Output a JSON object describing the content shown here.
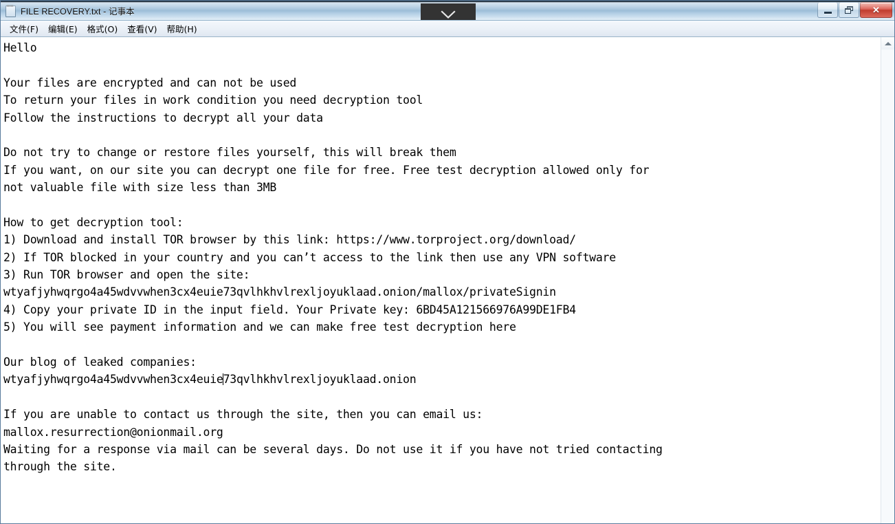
{
  "window": {
    "title": "FILE RECOVERY.txt - 记事本",
    "icon": "notepad-icon",
    "controls": {
      "minimize_label": "—",
      "restore_label": "❐",
      "close_label": "✕"
    }
  },
  "overlay": {
    "chevron_icon": "chevron-down-icon",
    "background_color": "#333333"
  },
  "menubar": {
    "items": [
      {
        "label": "文件(F)",
        "name": "menu-file"
      },
      {
        "label": "编辑(E)",
        "name": "menu-edit"
      },
      {
        "label": "格式(O)",
        "name": "menu-format"
      },
      {
        "label": "查看(V)",
        "name": "menu-view"
      },
      {
        "label": "帮助(H)",
        "name": "menu-help"
      }
    ]
  },
  "document": {
    "filename": "FILE RECOVERY.txt",
    "private_key": "6BD45A121566976A99DE1FB4",
    "tor_download_url": "https://www.torproject.org/download/",
    "onion_signin_url": "wtyafjyhwqrgo4a45wdvvwhen3cx4euie73qvlhkhvlrexljoyuklaad.onion/mallox/privateSignin",
    "onion_blog_url": "wtyafjyhwqrgo4a45wdvvwhen3cx4euie73qvlhkhvlrexljoyuklaad.onion",
    "email": "mallox.resurrection@onionmail.org",
    "max_free_file_size": "3MB",
    "lines": [
      "Hello",
      "",
      "Your files are encrypted and can not be used",
      "To return your files in work condition you need decryption tool",
      "Follow the instructions to decrypt all your data",
      "",
      "Do not try to change or restore files yourself, this will break them",
      "If you want, on our site you can decrypt one file for free. Free test decryption allowed only for",
      "not valuable file with size less than 3MB",
      "",
      "How to get decryption tool:",
      "1) Download and install TOR browser by this link: https://www.torproject.org/download/",
      "2) If TOR blocked in your country and you can’t access to the link then use any VPN software",
      "3) Run TOR browser and open the site:",
      "wtyafjyhwqrgo4a45wdvvwhen3cx4euie73qvlhkhvlrexljoyuklaad.onion/mallox/privateSignin",
      "4) Copy your private ID in the input field. Your Private key: 6BD45A121566976A99DE1FB4",
      "5) You will see payment information and we can make free test decryption here",
      "",
      "Our blog of leaked companies:",
      "",
      "",
      "If you are unable to contact us through the site, then you can email us:",
      "mallox.resurrection@onionmail.org",
      "Waiting for a response via mail can be several days. Do not use it if you have not tried contacting",
      "through the site."
    ],
    "caret_line": {
      "before_caret": "wtyafjyhwqrgo4a45wdvvwhen3cx4euie",
      "after_caret": "73qvlhkhvlrexljoyuklaad.onion"
    }
  },
  "scrollbar": {
    "up_arrow_icon": "scroll-up-arrow-icon",
    "orientation": "vertical"
  }
}
